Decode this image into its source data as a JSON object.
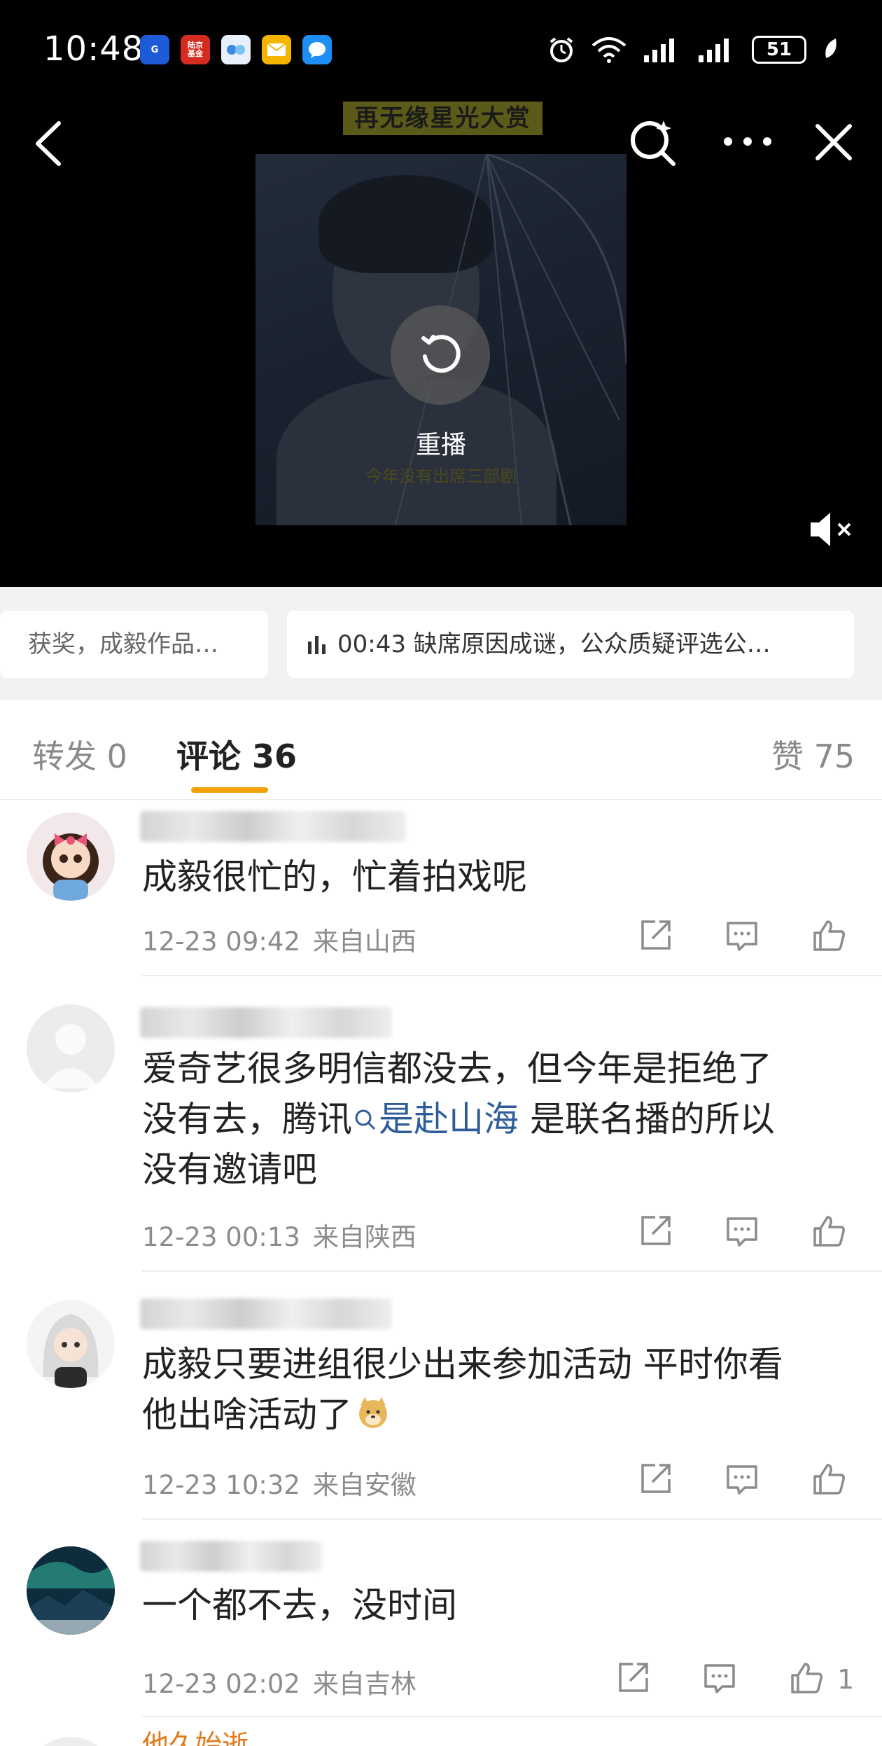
{
  "status_bar": {
    "time": "10:48",
    "apps": [
      {
        "name": "gdrcb-app-icon",
        "color": "#1e5bd8",
        "label": "G"
      },
      {
        "name": "fund-app-icon",
        "color": "#d62b1f",
        "label": "陆京\n基金"
      },
      {
        "name": "bank-app-icon",
        "color": "#4aa3f0",
        "label": "●"
      },
      {
        "name": "mail-app-icon",
        "color": "#f5b400",
        "label": "✉"
      },
      {
        "name": "message-app-icon",
        "color": "#1c8ef5",
        "label": "💬"
      }
    ],
    "battery": "51"
  },
  "video": {
    "title_strip": "再无缘星光大赏",
    "subtitle": "今年没有出席三部剧",
    "replay_label": "重播"
  },
  "related": {
    "left_chip": "获奖，成毅作品…",
    "right_chip": "00:43 缺席原因成谜，公众质疑评选公…"
  },
  "tabs": {
    "repost": "转发 0",
    "comments": "评论 36",
    "likes": "赞 75"
  },
  "comments": [
    {
      "text_lines": [
        "成毅很忙的，忙着拍戏呢"
      ],
      "time": "12-23 09:42",
      "location": "来自山西",
      "like_count": ""
    },
    {
      "text_a": "爱奇艺很多明信都没去，但今年是拒绝了",
      "text_b": "没有去，腾讯",
      "topic": "是赴山海",
      "text_c": " 是联名播的所以",
      "text_d": "没有邀请吧",
      "time": "12-23 00:13",
      "location": "来自陕西",
      "like_count": ""
    },
    {
      "text_a": "成毅只要进组很少出来参加活动 平时你看",
      "text_b": "他出啥活动了",
      "time": "12-23 10:32",
      "location": "来自安徽",
      "like_count": ""
    },
    {
      "text_lines": [
        "一个都不去，没时间"
      ],
      "time": "12-23 02:02",
      "location": "来自吉林",
      "like_count": "1"
    }
  ],
  "partial_next_username": "他久始逝"
}
